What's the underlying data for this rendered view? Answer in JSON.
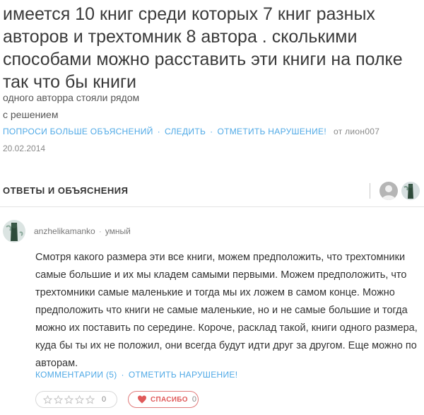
{
  "question": {
    "title": "имеется 10 книг среди которых 7 книг разных авторов и трехтомник 8 автора . сколькими способами можно расставить эти книги на полке так что бы книги",
    "line1": "одного авторра стояли рядом",
    "line2": "с решением",
    "actions": {
      "ask_more": "ПОПРОСИ БОЛЬШЕ ОБЪЯСНЕНИЙ",
      "follow": "СЛЕДИТЬ",
      "report": "ОТМЕТИТЬ НАРУШЕНИЕ!",
      "separator": "·",
      "author": "от лион007"
    },
    "date": "20.02.2014"
  },
  "answers_section": {
    "header": "ОТВЕТЫ И ОБЪЯСНЕНИЯ"
  },
  "answer": {
    "username": "anzhelikamanko",
    "rank": "умный",
    "dot": "·",
    "text": "Смотря какого размера эти все книги, можем предположить, что трехтомники самые большие и их мы кладем самыми первыми. Можем предположить, что трехтомники самые маленькие и тогда мы их ложем в самом конце. Можно предположить что книги не самые маленькие, но и не самые большие и тогда можно их поставить по середине. Короче, расклад такой, книги одного размера, куда бы ты их не положил, они всегда будут идти друг за другом. Еще можно по авторам.",
    "comments": "КОММЕНТАРИИ (5)",
    "report": "ОТМЕТИТЬ НАРУШЕНИЕ!",
    "separator": "·",
    "rating_count": "0",
    "thanks_label": "СПАСИБО",
    "thanks_count": "0"
  },
  "colors": {
    "link": "#4fa9e6",
    "heart": "#e05a5a",
    "star_outline": "#c8c8c8"
  },
  "icons": [
    "star-icon",
    "heart-icon",
    "avatar"
  ]
}
